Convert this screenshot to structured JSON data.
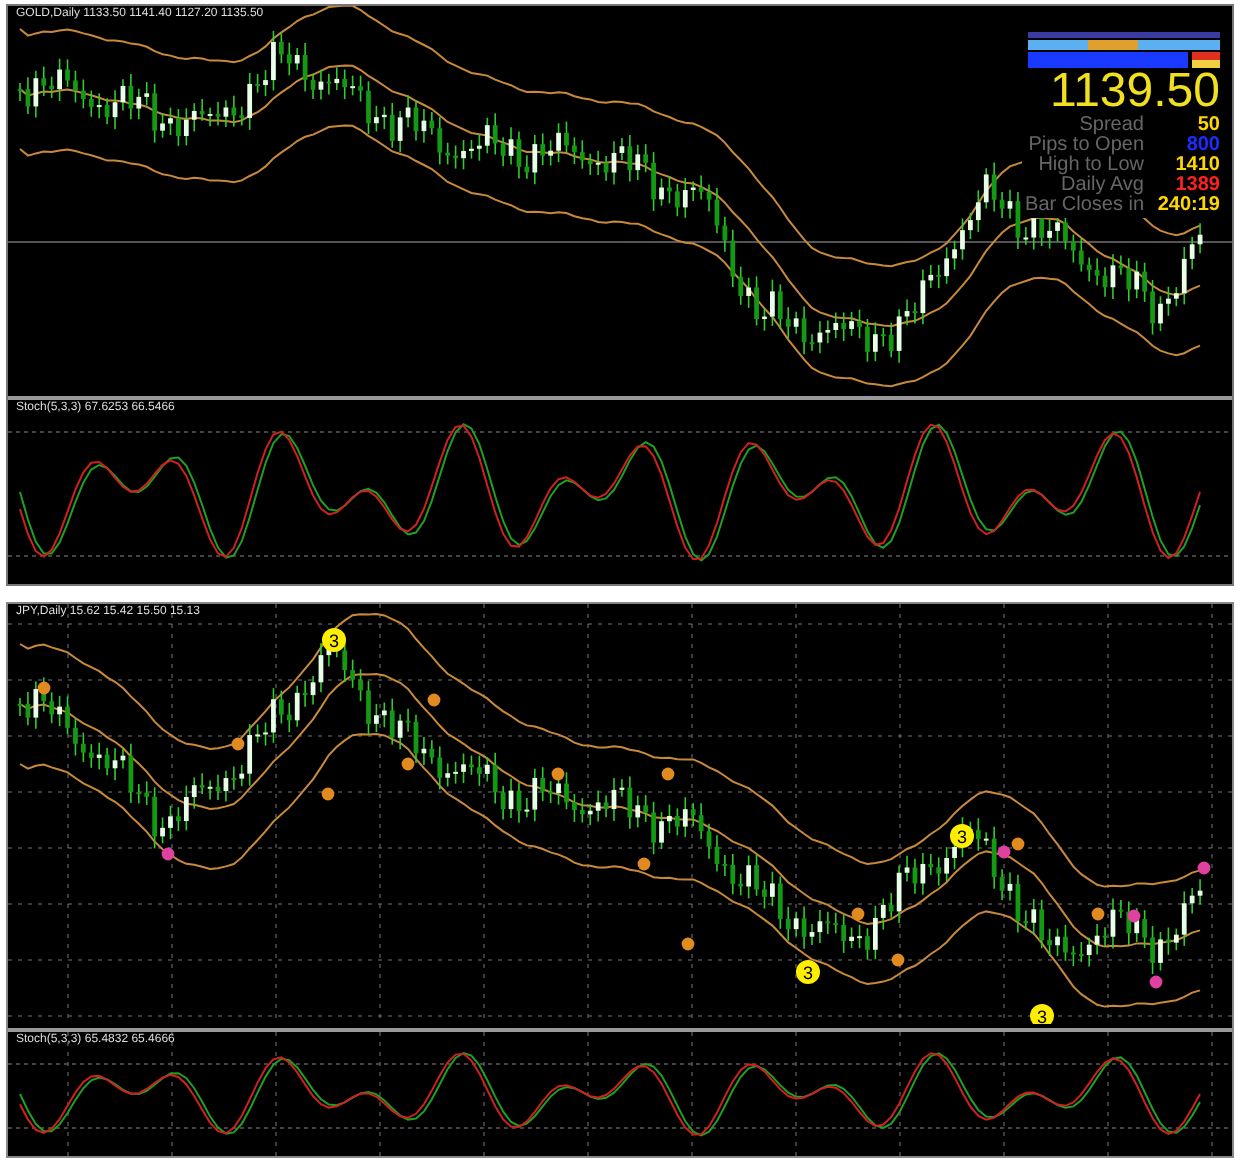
{
  "charts": [
    {
      "title": "GOLD,Daily 1133.50 1141.40 1127.20 1135.50",
      "indicator_title": "Stoch(5,3,3) 67.6253 66.5466",
      "grid": false,
      "info_panel": {
        "price": "1139.50",
        "rows": [
          {
            "label": "Spread",
            "value": "50",
            "color": "#ffd700"
          },
          {
            "label": "Pips to Open",
            "value": "800",
            "color": "#1a2cff"
          },
          {
            "label": "High to Low",
            "value": "1410",
            "color": "#ffd700"
          },
          {
            "label": "Daily Avg",
            "value": "1389",
            "color": "#ff2020"
          },
          {
            "label": "Bar Closes in",
            "value": "240:19",
            "color": "#ffd700"
          }
        ]
      }
    },
    {
      "title": "JPY,Daily 15.62 15.42 15.50 15.13",
      "indicator_title": "Stoch(5,3,3) 65.4832 65.4666",
      "grid": true,
      "markers": [
        {
          "label": "3",
          "color": "#ffee00"
        },
        {
          "label": "3",
          "color": "#ffee00"
        },
        {
          "label": "3",
          "color": "#ffee00"
        },
        {
          "label": "3",
          "color": "#ffee00"
        }
      ]
    }
  ]
}
